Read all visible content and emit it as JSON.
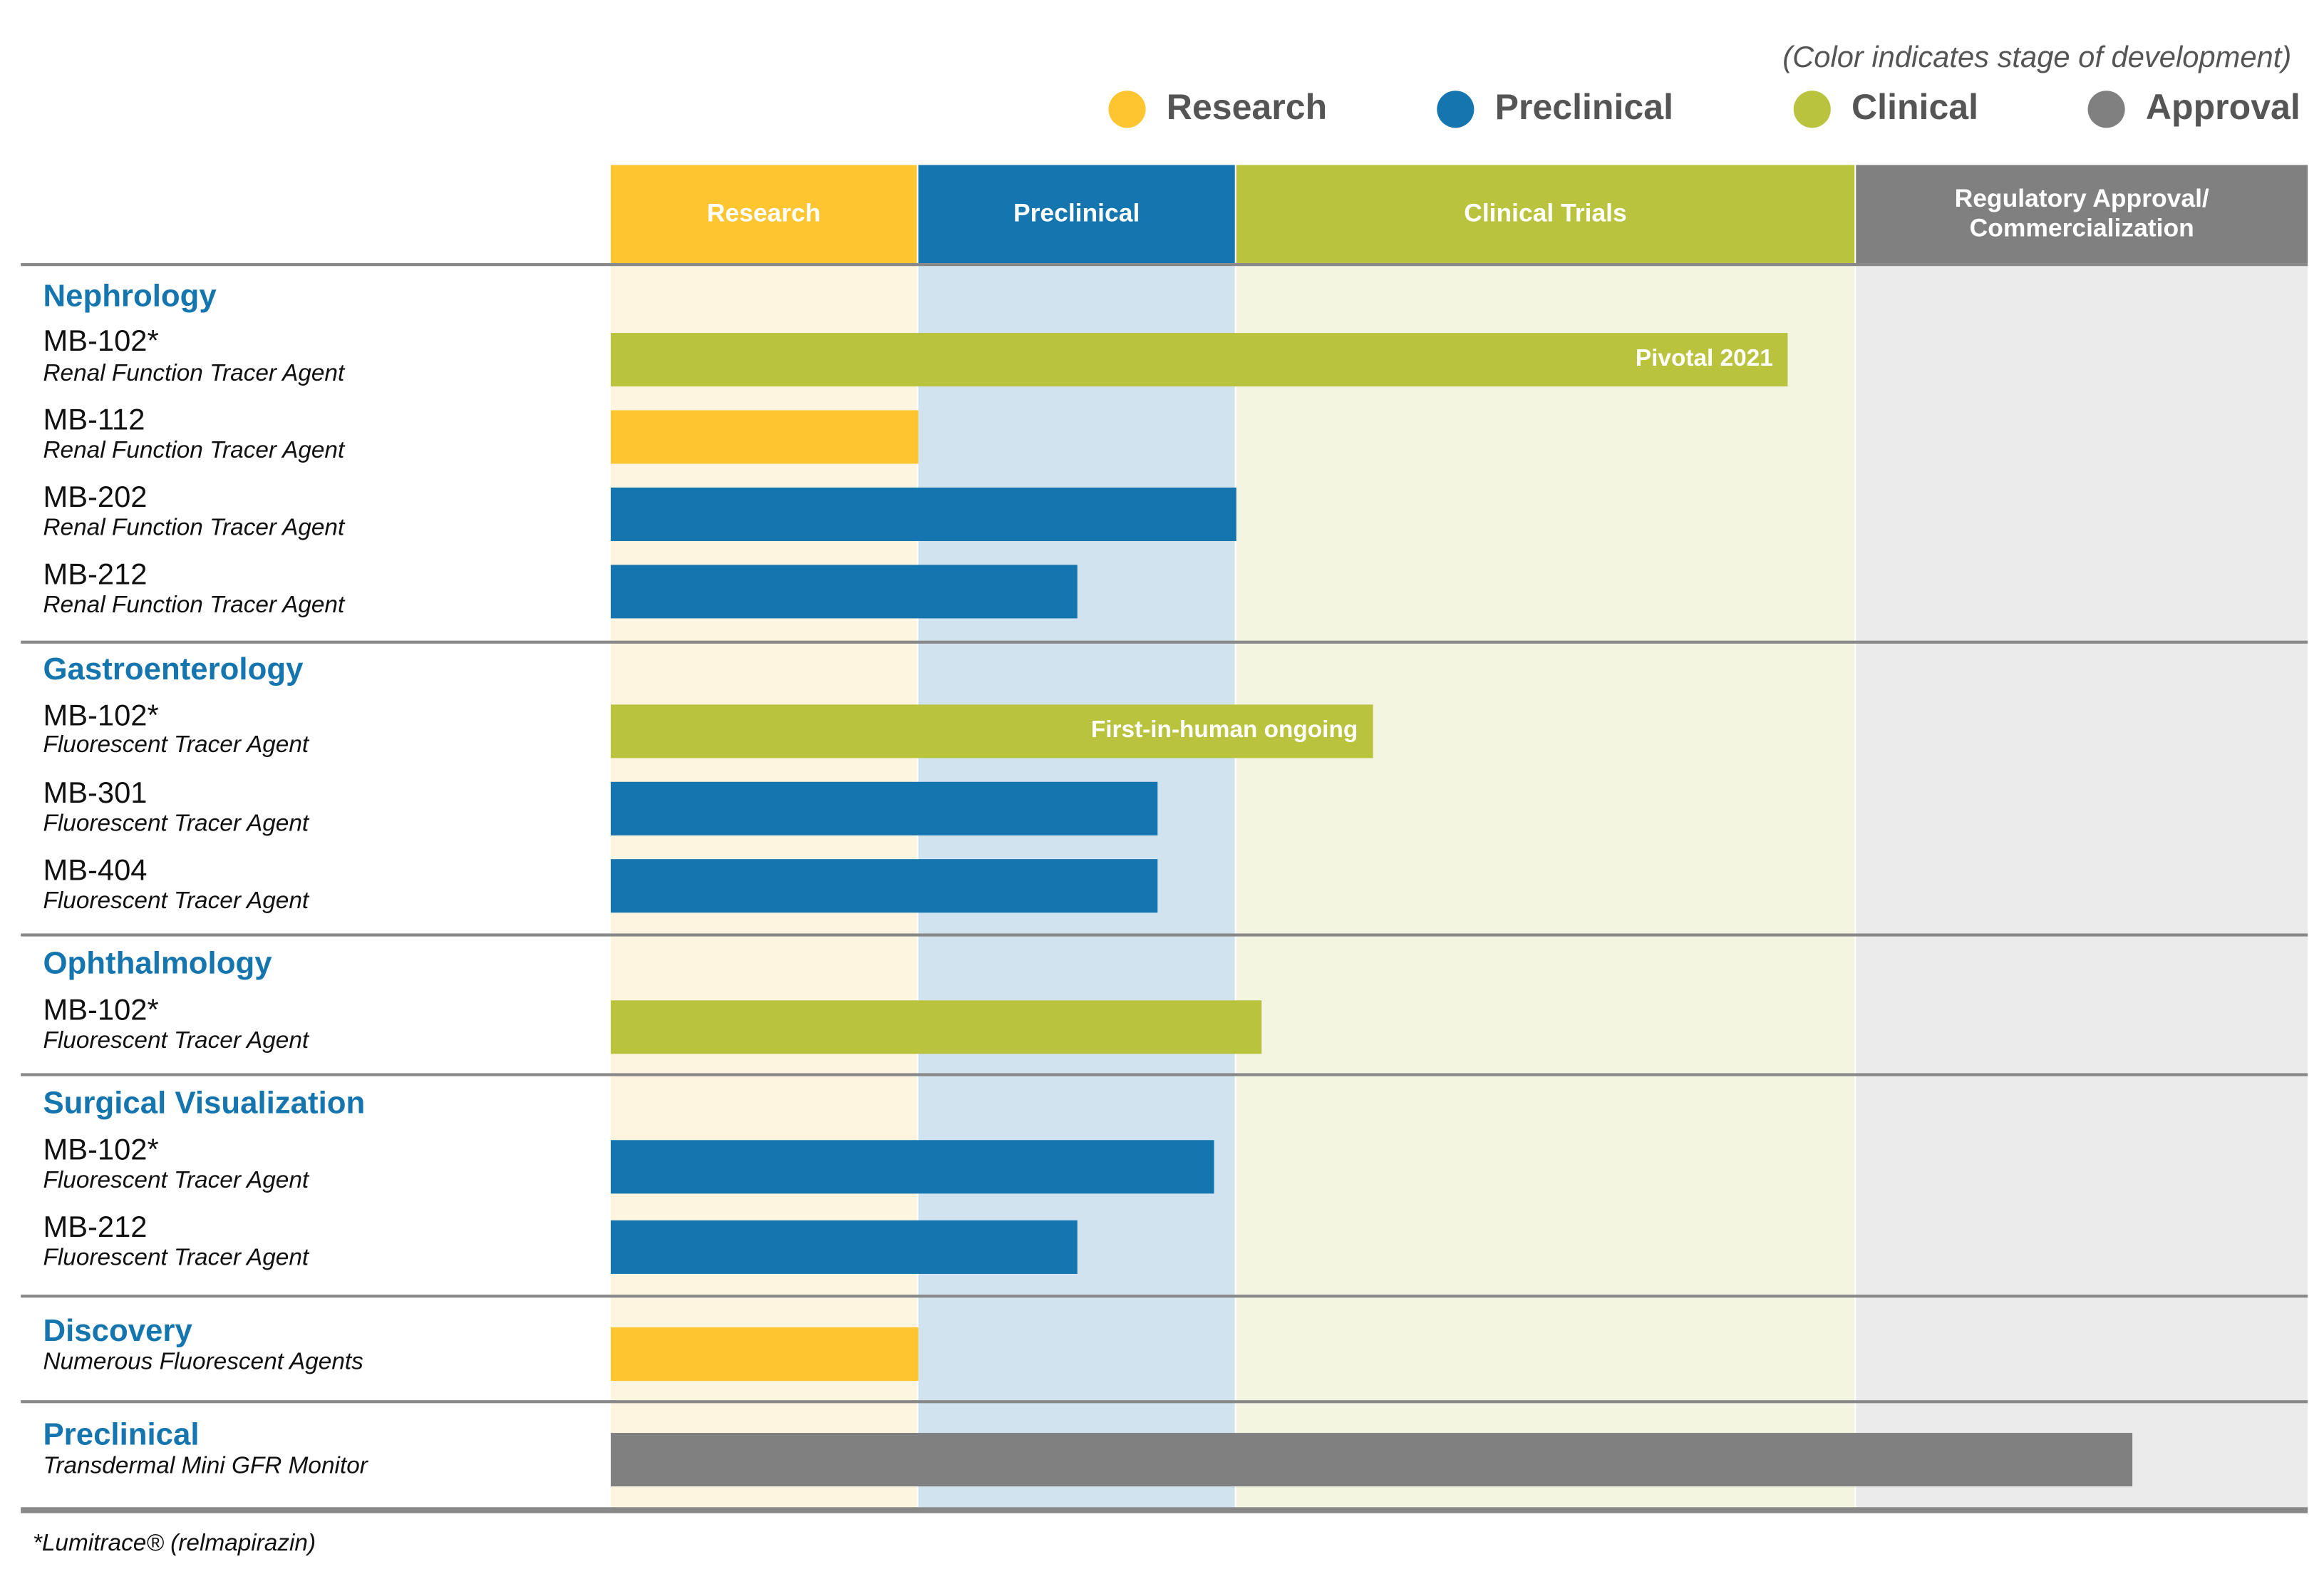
{
  "legend": {
    "note": "(Color indicates stage of development)",
    "items": [
      {
        "label": "Research",
        "color": "#fdc530"
      },
      {
        "label": "Preclinical",
        "color": "#1575ae"
      },
      {
        "label": "Clinical",
        "color": "#b9c33e"
      },
      {
        "label": "Approval",
        "color": "#808080"
      }
    ]
  },
  "chart_data": {
    "type": "bar",
    "orientation": "horizontal-gantt",
    "progress_scale": "stages completed (0-4): 1 = end of Research, 2 = end of Preclinical, 3 = end of Clinical Trials, 4 = end of Regulatory Approval/Commercialization",
    "stages": [
      {
        "label": "Research",
        "color": "#fdc530",
        "bg": "#fdf5df"
      },
      {
        "label": "Preclinical",
        "color": "#1575ae",
        "bg": "#d1e3ef"
      },
      {
        "label": "Clinical Trials",
        "color": "#b9c33e",
        "bg": "#f3f5e1"
      },
      {
        "label": "Regulatory Approval/\nCommercialization",
        "color": "#808080",
        "bg": "#ebebeb"
      }
    ],
    "groups": [
      {
        "name": "Nephrology",
        "rows": [
          {
            "name": "MB-102*",
            "sub": "Renal Function Tracer Agent",
            "stage": "Clinical",
            "progress": 2.89,
            "label": "Pivotal 2021"
          },
          {
            "name": "MB-112",
            "sub": "Renal Function Tracer Agent",
            "stage": "Research",
            "progress": 1.0,
            "label": ""
          },
          {
            "name": "MB-202",
            "sub": "Renal Function Tracer Agent",
            "stage": "Preclinical",
            "progress": 2.0,
            "label": ""
          },
          {
            "name": "MB-212",
            "sub": "Renal Function Tracer Agent",
            "stage": "Preclinical",
            "progress": 1.5,
            "label": ""
          }
        ]
      },
      {
        "name": "Gastroenterology",
        "rows": [
          {
            "name": "MB-102*",
            "sub": "Fluorescent Tracer Agent",
            "stage": "Clinical",
            "progress": 2.22,
            "label": "First-in-human ongoing"
          },
          {
            "name": "MB-301",
            "sub": "Fluorescent Tracer Agent",
            "stage": "Preclinical",
            "progress": 1.75,
            "label": ""
          },
          {
            "name": "MB-404",
            "sub": "Fluorescent Tracer Agent",
            "stage": "Preclinical",
            "progress": 1.75,
            "label": ""
          }
        ]
      },
      {
        "name": "Ophthalmology",
        "rows": [
          {
            "name": "MB-102*",
            "sub": "Fluorescent Tracer Agent",
            "stage": "Clinical",
            "progress": 2.04,
            "label": ""
          }
        ]
      },
      {
        "name": "Surgical Visualization",
        "rows": [
          {
            "name": "MB-102*",
            "sub": "Fluorescent Tracer Agent",
            "stage": "Preclinical",
            "progress": 1.93,
            "label": ""
          },
          {
            "name": "MB-212",
            "sub": "Fluorescent Tracer Agent",
            "stage": "Preclinical",
            "progress": 1.5,
            "label": ""
          }
        ]
      },
      {
        "name": "Discovery",
        "rows": [
          {
            "name": "",
            "sub": "Numerous Fluorescent Agents",
            "stage": "Research",
            "progress": 1.0,
            "label": ""
          }
        ]
      },
      {
        "name": "Preclinical",
        "rows": [
          {
            "name": "",
            "sub": "Transdermal Mini GFR Monitor",
            "stage": "Approval",
            "progress": 3.61,
            "label": ""
          }
        ]
      }
    ]
  },
  "footnote": "*Lumitrace® (relmapirazin)"
}
